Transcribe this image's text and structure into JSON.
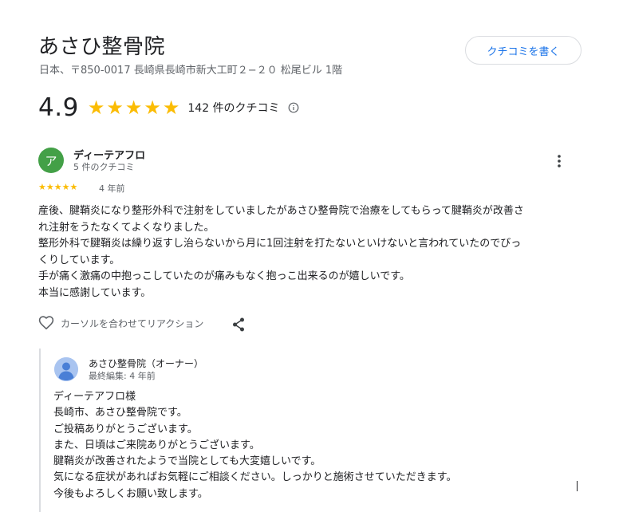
{
  "business": {
    "name": "あさひ整骨院",
    "address": "日本、〒850-0017 長崎県長崎市新大工町２−２０ 松尾ビル 1階",
    "write_review_label": "クチコミを書く",
    "rating": "4.9",
    "rating_stars": 5,
    "review_count_label": "142 件のクチコミ"
  },
  "review": {
    "avatar_letter": "ア",
    "avatar_color": "#43a047",
    "reviewer_name": "ディーテアフロ",
    "reviewer_sub": "5 件のクチコミ",
    "stars": 5,
    "age": "4 年前",
    "lines": [
      "産後、腱鞘炎になり整形外科で注射をしていましたがあさひ整骨院で治療をしてもらって腱鞘炎が改善さ",
      "れ注射をうたなくてよくなりました。",
      "整形外科で腱鞘炎は繰り返すし治らないから月に1回注射を打たないといけないと言われていたのでびっ",
      "くりしています。",
      "手が痛く激痛の中抱っこしていたのが痛みもなく抱っこ出来るのが嬉しいです。",
      "本当に感謝しています。"
    ],
    "reaction_label": "カーソルを合わせてリアクション"
  },
  "owner_response": {
    "name": "あさひ整骨院（オーナー）",
    "edited": "最終編集: 4 年前",
    "lines": [
      "ディーテアフロ様",
      "長崎市、あさひ整骨院です。",
      "ご投稿ありがとうございます。",
      "また、日頃はご来院ありがとうございます。",
      "腱鞘炎が改善されたようで当院としても大変嬉しいです。",
      "気になる症状があればお気軽にご相談ください。しっかりと施術させていただきます。",
      "今後もよろしくお願い致します。"
    ]
  },
  "colors": {
    "star": "#fbbc04",
    "accent": "#1a73e8",
    "secondary_text": "#5f6368"
  },
  "icons": [
    "star-icon",
    "info-icon",
    "more-vert-icon",
    "heart-outline-icon",
    "share-icon",
    "person-avatar-icon"
  ]
}
